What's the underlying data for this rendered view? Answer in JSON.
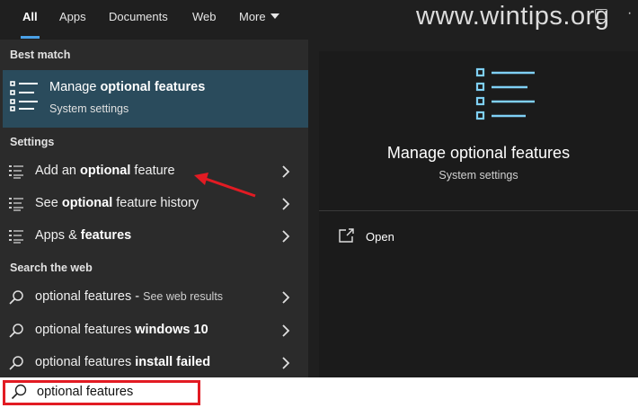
{
  "tabs": [
    {
      "label": "All",
      "active": true
    },
    {
      "label": "Apps"
    },
    {
      "label": "Documents"
    },
    {
      "label": "Web"
    },
    {
      "label": "More"
    }
  ],
  "watermark": "www.wintips.org",
  "sections": {
    "best_match": "Best match",
    "settings": "Settings",
    "search_web": "Search the web"
  },
  "best_match": {
    "title_prefix": "Manage ",
    "title_bold": "optional features",
    "subtitle": "System settings",
    "icon": "list-icon"
  },
  "settings_items": [
    {
      "pre": "Add an ",
      "bold": "optional",
      "post": " feature",
      "icon": "list-icon"
    },
    {
      "pre": "See ",
      "bold": "optional",
      "post": " feature history",
      "icon": "list-icon"
    },
    {
      "pre": "Apps & ",
      "bold": "features",
      "post": "",
      "icon": "list-icon"
    }
  ],
  "web_items": [
    {
      "pre": "optional features",
      "bold": "",
      "post": " - ",
      "sub": "See web results",
      "icon": "search-icon"
    },
    {
      "pre": "optional features ",
      "bold": "windows 10",
      "post": "",
      "sub": "",
      "icon": "search-icon"
    },
    {
      "pre": "optional features ",
      "bold": "install failed",
      "post": "",
      "sub": "",
      "icon": "search-icon"
    }
  ],
  "detail": {
    "title": "Manage optional features",
    "subtitle": "System settings",
    "action_label": "Open",
    "icon_color": "#7fd0f5"
  },
  "search": {
    "value": "optional features"
  },
  "colors": {
    "accent": "#4aa0e6",
    "selected_bg": "#2a4b5c",
    "annotation_red": "#e21b23"
  }
}
